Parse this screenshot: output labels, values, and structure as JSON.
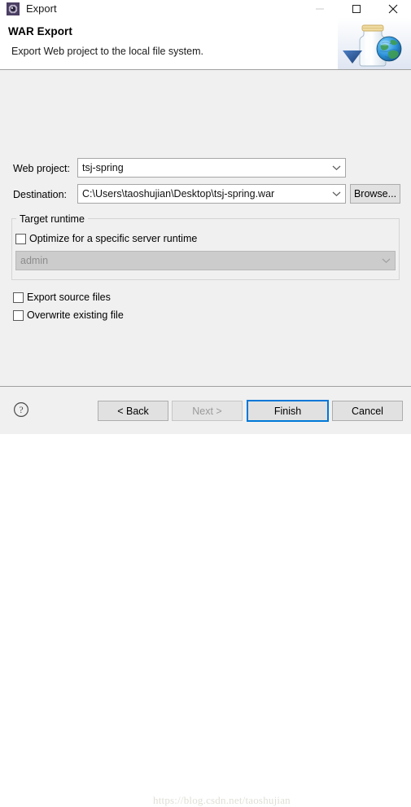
{
  "window": {
    "title": "Export",
    "icon": "export-wizard-icon",
    "controls": {
      "minimize_label": "—",
      "minimize_icon": "minimize-icon",
      "minimize_enabled": false,
      "maximize_label": "□",
      "maximize_icon": "maximize-icon",
      "close_label": "✕",
      "close_icon": "close-icon"
    }
  },
  "header": {
    "title": "WAR Export",
    "description": "Export Web project to the local file system.",
    "graphic_icon": "war-jar-globe-icon"
  },
  "form": {
    "web_project": {
      "label": "Web project:",
      "value": "tsj-spring",
      "placeholder": "",
      "arrow_icon": "chevron-down-icon"
    },
    "destination": {
      "label": "Destination:",
      "value": "C:\\Users\\taoshujian\\Desktop\\tsj-spring.war",
      "placeholder": "",
      "arrow_icon": "chevron-down-icon"
    },
    "browse_button": {
      "label": "Browse..."
    }
  },
  "target_runtime": {
    "group_label": "Target runtime",
    "optimize_checkbox": {
      "label": "Optimize for a specific server runtime",
      "checked": false
    },
    "runtime_combo": {
      "value": "admin",
      "enabled": false,
      "arrow_icon": "chevron-down-icon"
    }
  },
  "options": [
    {
      "label": "Export source files",
      "checked": false,
      "name": "export-source-files"
    },
    {
      "label": "Overwrite existing file",
      "checked": false,
      "name": "overwrite-existing-file"
    }
  ],
  "footer": {
    "help_icon": "help-question-icon",
    "buttons": {
      "back": {
        "label": "< Back",
        "enabled": true
      },
      "next": {
        "label": "Next >",
        "enabled": false
      },
      "finish": {
        "label": "Finish",
        "enabled": true,
        "default": true
      },
      "cancel": {
        "label": "Cancel",
        "enabled": true
      }
    },
    "watermark": "https://blog.csdn.net/taoshujian"
  },
  "colors": {
    "dialog_background": "#f0f0f0",
    "header_background": "#ffffff",
    "focus_blue": "#0078d7",
    "button_face": "#e1e1e1",
    "disabled_text": "#9a9a9a",
    "disabled_field": "#cccccc",
    "separator": "#a0a0a0"
  }
}
